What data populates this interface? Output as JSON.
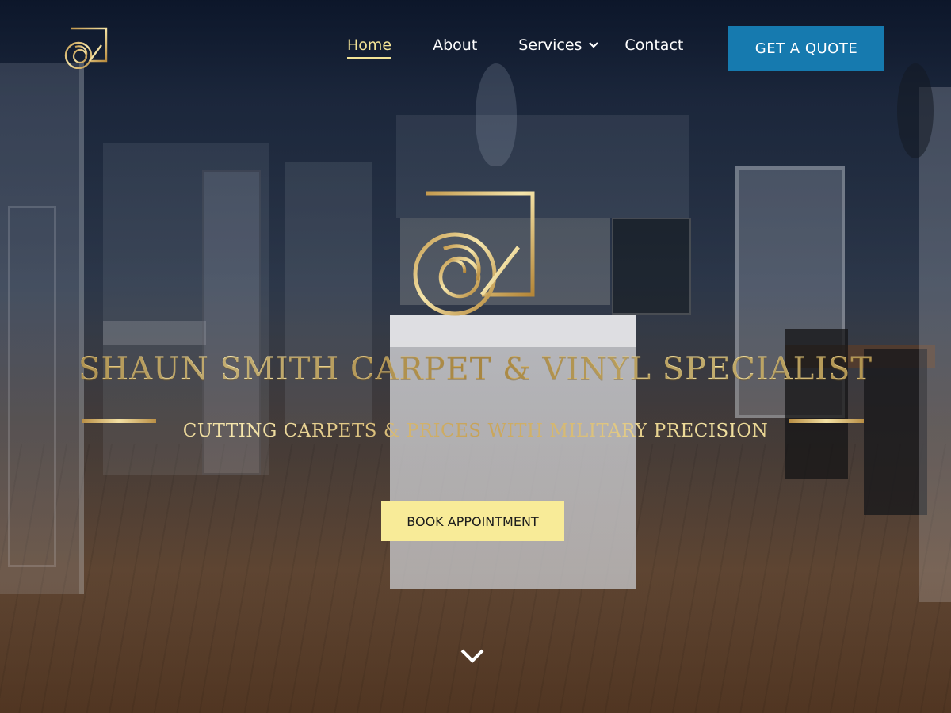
{
  "nav": {
    "items": [
      {
        "label": "Home",
        "active": true
      },
      {
        "label": "About",
        "active": false
      },
      {
        "label": "Services",
        "active": false,
        "has_dropdown": true
      },
      {
        "label": "Contact",
        "active": false
      }
    ],
    "cta_label": "GET A QUOTE"
  },
  "hero": {
    "title": "SHAUN SMITH CARPET & VINYL SPECIALIST",
    "subtitle": "CUTTING CARPETS & PRICES WITH MILITARY PRECISION",
    "button_label": "BOOK APPOINTMENT"
  },
  "icons": {
    "logo": "brand-logo-icon",
    "dropdown": "chevron-down-icon",
    "scroll": "chevron-down-icon"
  },
  "colors": {
    "accent_gold": "#e9d69a",
    "cta_blue": "#167aaf",
    "button_yellow": "#f8eb98",
    "nav_active": "#f4e497"
  }
}
